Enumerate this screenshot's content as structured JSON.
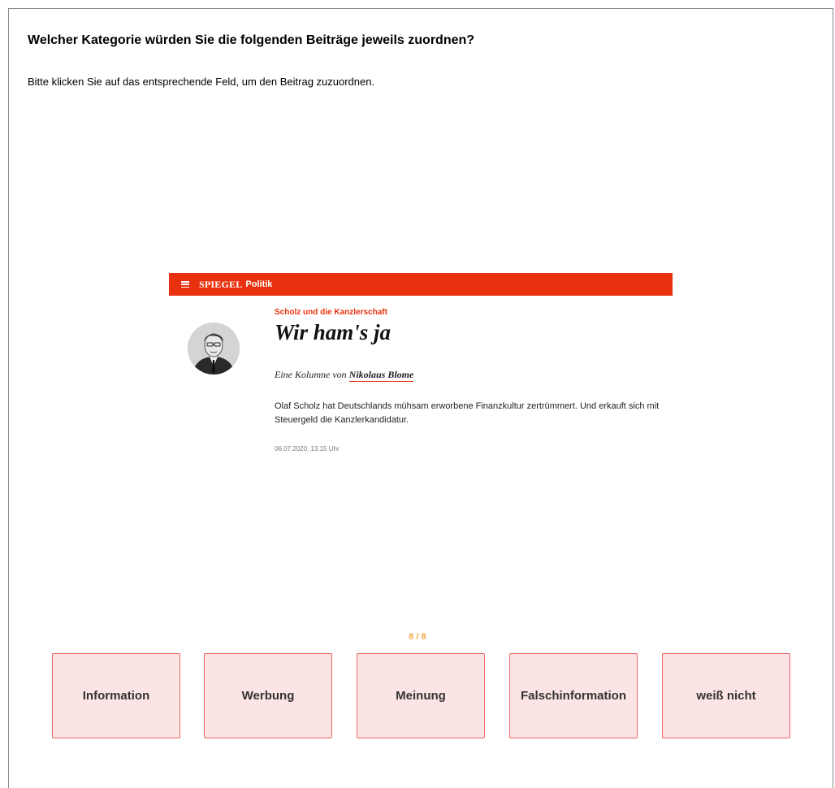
{
  "survey": {
    "question": "Welcher Kategorie würden Sie die folgenden Beiträge jeweils zuordnen?",
    "instruction": "Bitte klicken Sie auf das entsprechende Feld, um den Beitrag zuzuordnen.",
    "progress": "8 / 8"
  },
  "article": {
    "brand": "SPIEGEL",
    "section": "Politik",
    "kicker": "Scholz und die Kanzlerschaft",
    "headline": "Wir ham's ja",
    "byline_prefix": "Eine Kolumne von",
    "author": "Nikolaus Blome",
    "teaser": "Olaf Scholz hat Deutschlands mühsam erworbene Finanzkultur zertrümmert. Und erkauft sich mit Steuergeld die Kanzlerkandidatur.",
    "date": "06.07.2020, 13.15 Uhr",
    "bar_color": "#e8320f"
  },
  "categories": [
    {
      "label": "Information"
    },
    {
      "label": "Werbung"
    },
    {
      "label": "Meinung"
    },
    {
      "label": "Falschinformation"
    },
    {
      "label": "weiß nicht"
    }
  ],
  "colors": {
    "button_bg": "#fde4e4",
    "button_border": "#ec6868",
    "progress": "#f4a742"
  }
}
